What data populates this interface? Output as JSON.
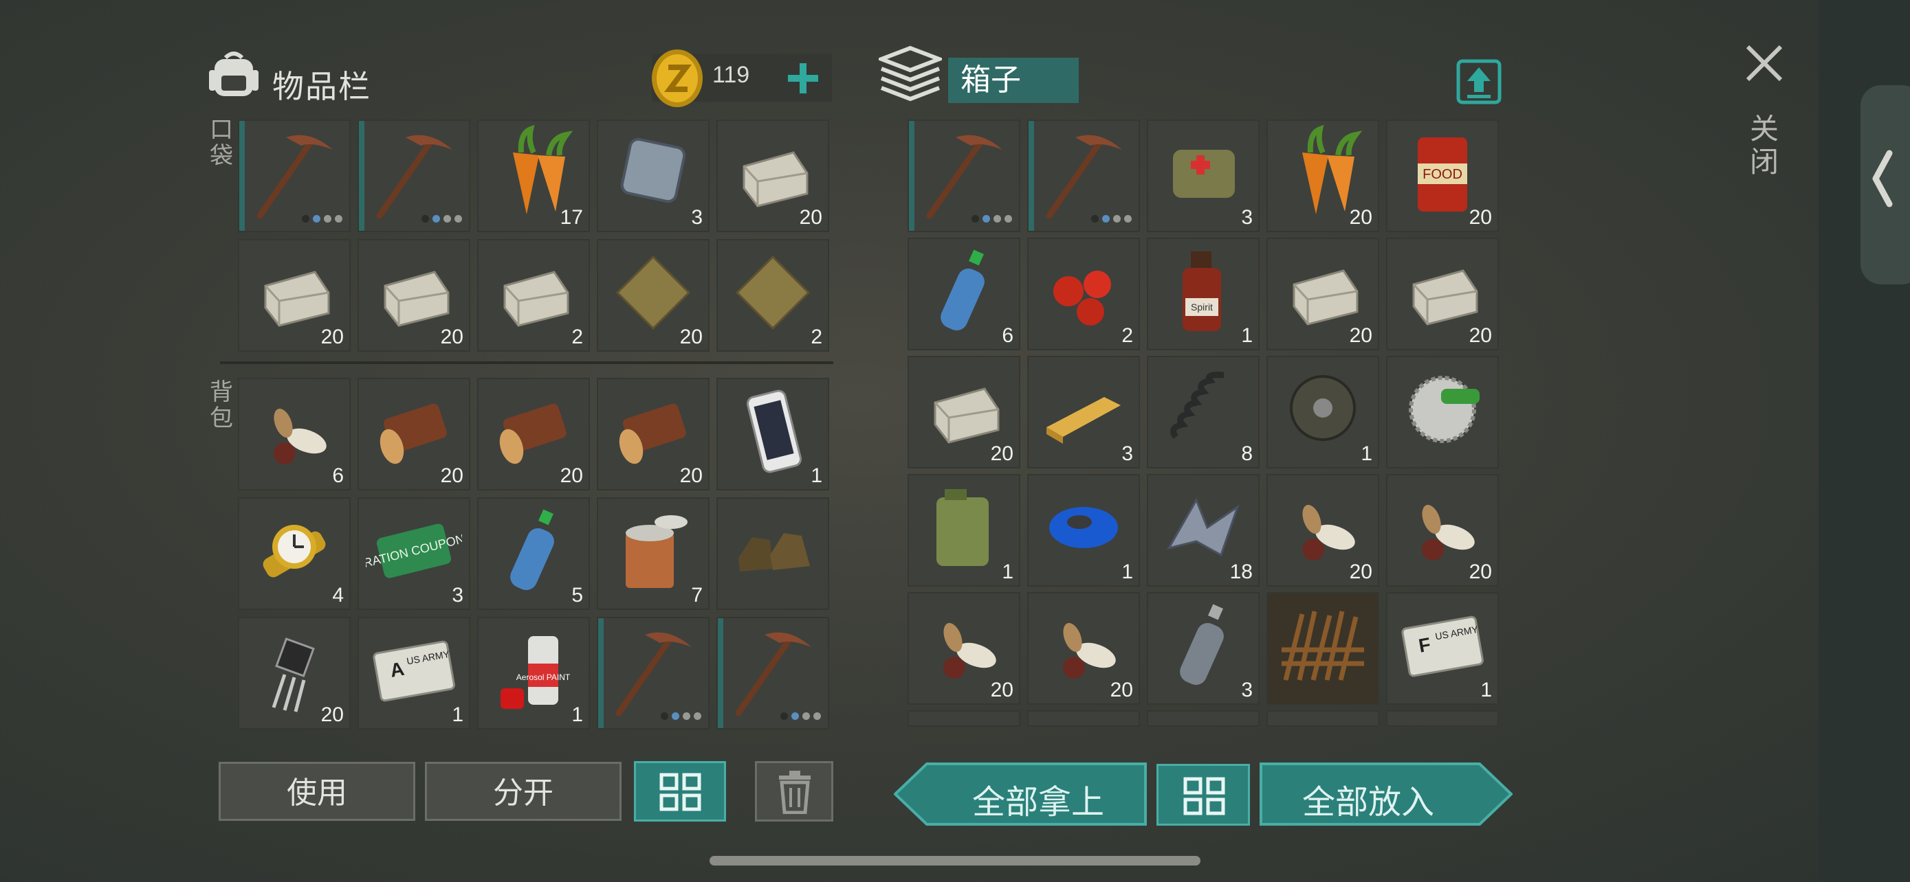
{
  "inventory": {
    "title": "物品栏",
    "coins": "119",
    "pocket_label": "口袋",
    "backpack_label": "背包",
    "pocket_slots": [
      {
        "item": "pickaxe",
        "count": "",
        "durability": 2
      },
      {
        "item": "pickaxe",
        "count": "",
        "durability": 2
      },
      {
        "item": "carrot",
        "count": "17"
      },
      {
        "item": "iron-plate",
        "count": "3"
      },
      {
        "item": "stone",
        "count": "20"
      },
      {
        "item": "stone",
        "count": "20"
      },
      {
        "item": "stone",
        "count": "20"
      },
      {
        "item": "stone",
        "count": "2"
      },
      {
        "item": "cloth",
        "count": "20"
      },
      {
        "item": "cloth",
        "count": "2"
      }
    ],
    "backpack_slots": [
      {
        "item": "seeds",
        "count": "6"
      },
      {
        "item": "log",
        "count": "20"
      },
      {
        "item": "log",
        "count": "20"
      },
      {
        "item": "log",
        "count": "20"
      },
      {
        "item": "phone",
        "count": "1"
      },
      {
        "item": "watch",
        "count": "4"
      },
      {
        "item": "ration-coupon",
        "count": "3",
        "label": "RATION COUPON"
      },
      {
        "item": "water-bottle",
        "count": "5"
      },
      {
        "item": "open-can",
        "count": "7"
      },
      {
        "item": "boots",
        "count": ""
      },
      {
        "item": "transistor",
        "count": "20"
      },
      {
        "item": "army-card-a",
        "count": "1",
        "letter": "A",
        "label": "US ARMY"
      },
      {
        "item": "spray-paint",
        "count": "1",
        "label": "Aerosol PAINT"
      },
      {
        "item": "pickaxe",
        "count": "",
        "durability": 2
      },
      {
        "item": "pickaxe",
        "count": "",
        "durability": 2
      }
    ],
    "buttons": {
      "use": "使用",
      "split": "分开"
    }
  },
  "chest": {
    "title": "箱子",
    "slots": [
      {
        "item": "pickaxe",
        "count": "",
        "durability": 2
      },
      {
        "item": "pickaxe",
        "count": "",
        "durability": 2
      },
      {
        "item": "medkit-bag",
        "count": "3"
      },
      {
        "item": "carrot",
        "count": "20"
      },
      {
        "item": "canned-food",
        "count": "20",
        "label": "FOOD"
      },
      {
        "item": "water-bottle",
        "count": "6"
      },
      {
        "item": "berries",
        "count": "2"
      },
      {
        "item": "spirit-bottle",
        "count": "1",
        "label": "Spirit"
      },
      {
        "item": "stone",
        "count": "20"
      },
      {
        "item": "stone",
        "count": "20"
      },
      {
        "item": "stone",
        "count": "20"
      },
      {
        "item": "plank",
        "count": "3"
      },
      {
        "item": "spring",
        "count": "8"
      },
      {
        "item": "wheel",
        "count": "1"
      },
      {
        "item": "saw-blade",
        "count": ""
      },
      {
        "item": "jerrycan",
        "count": "1"
      },
      {
        "item": "tape",
        "count": "1"
      },
      {
        "item": "scrap-metal",
        "count": "18"
      },
      {
        "item": "seeds",
        "count": "20"
      },
      {
        "item": "seeds",
        "count": "20"
      },
      {
        "item": "seeds",
        "count": "20"
      },
      {
        "item": "seeds",
        "count": "20"
      },
      {
        "item": "empty-bottle",
        "count": "3"
      },
      {
        "item": "spike-trap",
        "count": ""
      },
      {
        "item": "army-card-f",
        "count": "1",
        "letter": "F",
        "label": "US ARMY"
      }
    ],
    "buttons": {
      "take_all": "全部拿上",
      "put_all": "全部放入"
    }
  },
  "close_label": "关闭",
  "colors": {
    "accent": "#2b807a",
    "accent_border": "#48aea6",
    "slot_bg": "#3e403c"
  }
}
